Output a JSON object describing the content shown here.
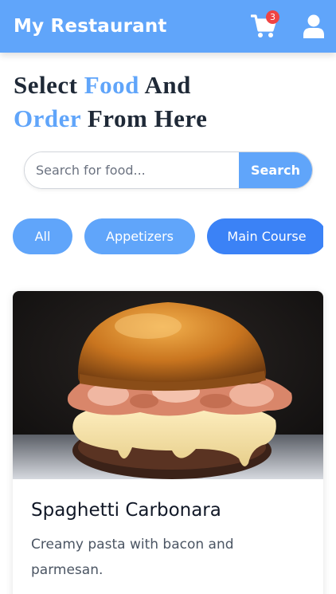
{
  "header": {
    "brand": "My Restaurant",
    "cart_count": "3",
    "cart_icon": "shopping-cart-icon",
    "user_icon": "user-icon"
  },
  "hero": {
    "word1": "Select",
    "word2": "Food",
    "word3": "And",
    "word4": "Order",
    "word5": "From Here"
  },
  "search": {
    "placeholder": "Search for food...",
    "button_label": "Search"
  },
  "categories": [
    {
      "label": "All",
      "active": false
    },
    {
      "label": "Appetizers",
      "active": false
    },
    {
      "label": "Main Course",
      "active": true
    }
  ],
  "menu": {
    "items": [
      {
        "title": "Spaghetti Carbonara",
        "description": "Creamy pasta with bacon and parmesan.",
        "image": "burger-photo"
      }
    ]
  },
  "colors": {
    "primary": "#60a5fa",
    "active": "#3b82f6",
    "badge": "#ef4444",
    "text": "#1f2937"
  }
}
